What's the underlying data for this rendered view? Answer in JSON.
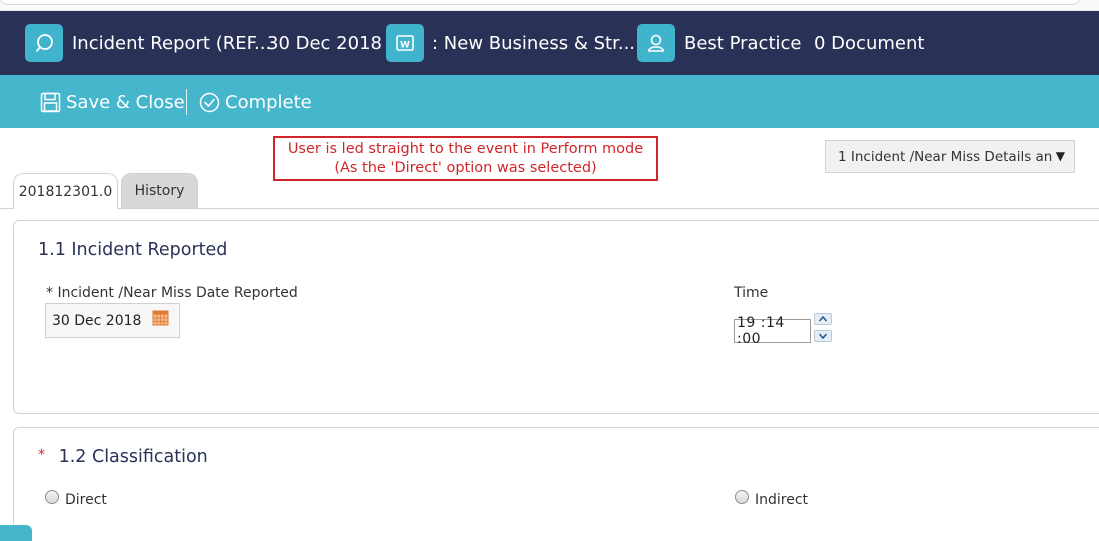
{
  "header": {
    "incident_title": "Incident Report (REF...",
    "date": "30 Dec 2018",
    "workspace": ": New Business & Str...",
    "assignee": "Best Practice",
    "documents": "0 Document"
  },
  "toolbar": {
    "save_close_label": "Save & Close",
    "complete_label": "Complete"
  },
  "callout": {
    "line1": "User is led straight to the event in Perform mode",
    "line2": "(As the 'Direct' option was selected)"
  },
  "section_selector": {
    "selected": "1 Incident /Near Miss Details an"
  },
  "tabs": [
    {
      "label": "201812301.0",
      "active": true
    },
    {
      "label": "History",
      "active": false
    }
  ],
  "section1": {
    "title": "1.1 Incident Reported",
    "date_label": "* Incident /Near Miss Date Reported",
    "date_value": "30 Dec 2018",
    "time_label": "Time",
    "time_value": "19 :14 :00"
  },
  "section2": {
    "required_marker": "*",
    "title": "1.2 Classification",
    "options": [
      {
        "label": "Direct",
        "selected": false
      },
      {
        "label": "Indirect",
        "selected": false
      }
    ]
  },
  "colors": {
    "header_bg": "#2a3157",
    "toolbar_bg": "#46b6cd",
    "icon_bg": "#3fb4cc",
    "callout_red": "#d0262b",
    "title_navy": "#2a3157"
  },
  "icons": [
    "search-bubble-icon",
    "workspace-w-icon",
    "user-icon",
    "save-disk-icon",
    "check-circle-icon",
    "calendar-icon",
    "spin-up-icon",
    "spin-down-icon"
  ]
}
